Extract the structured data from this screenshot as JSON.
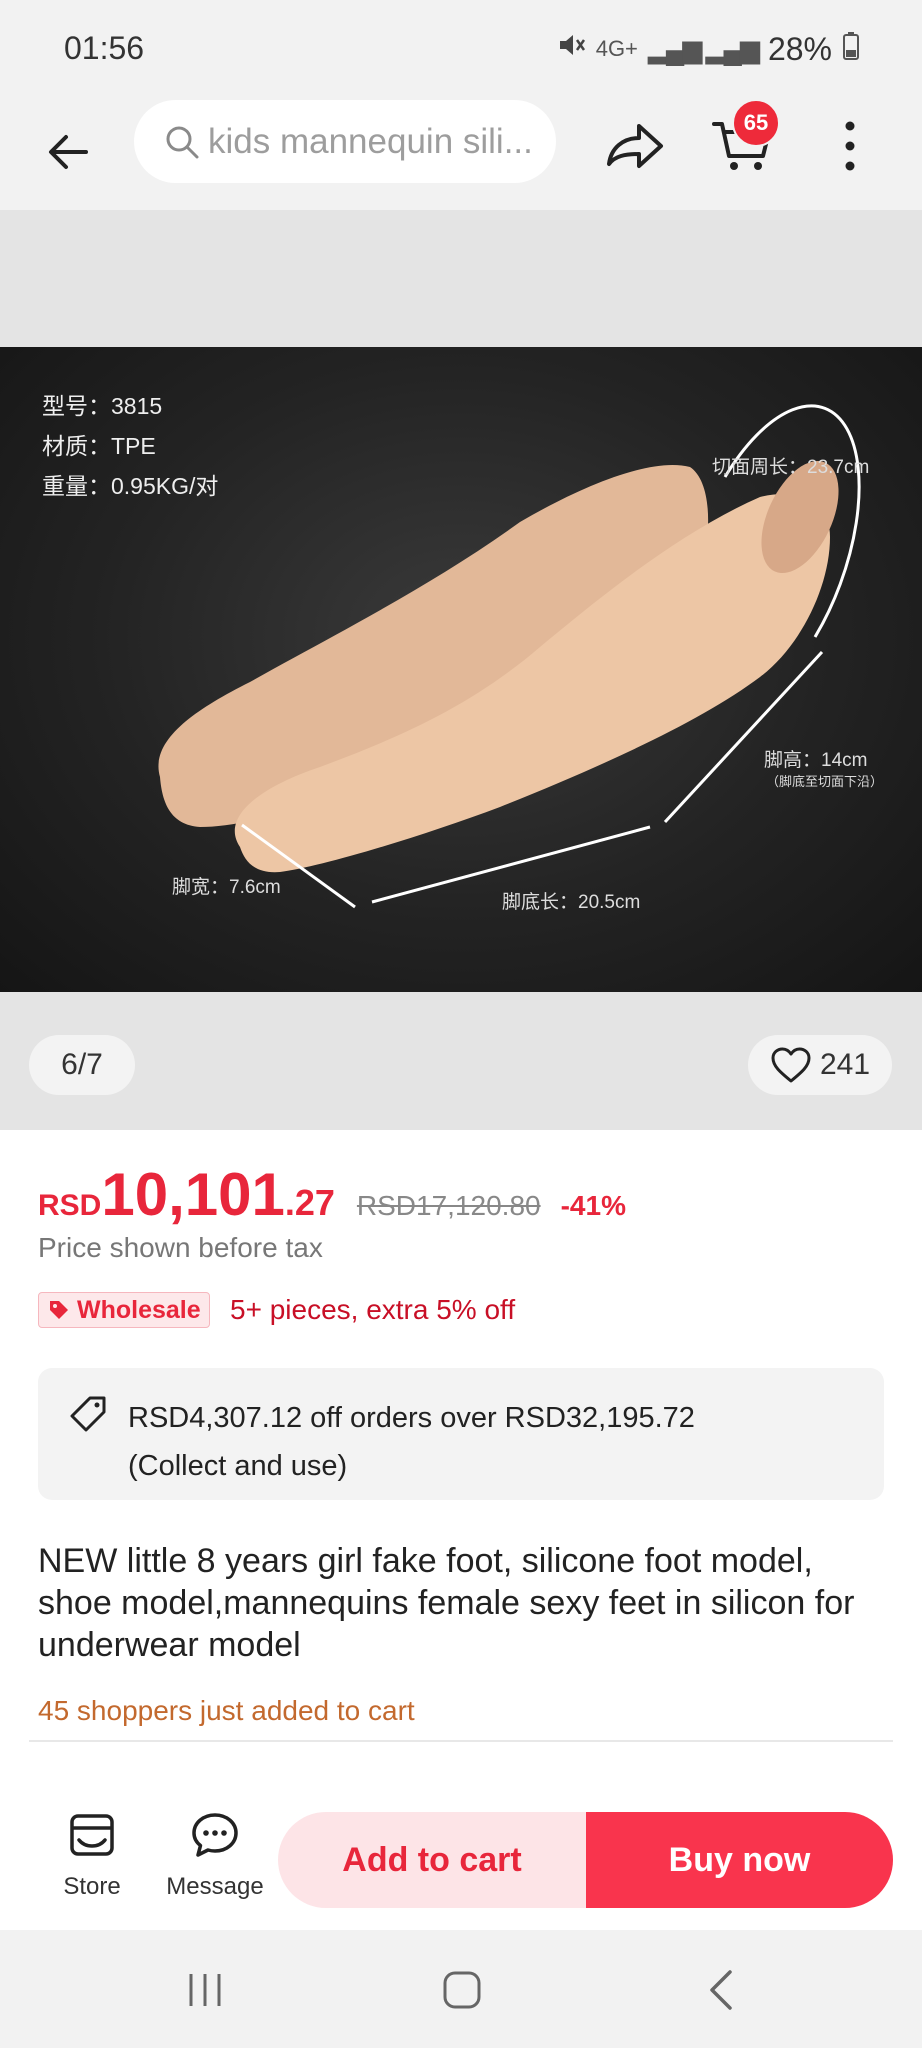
{
  "status_bar": {
    "time": "01:56",
    "network": "4G+",
    "battery": "28%"
  },
  "top_bar": {
    "search_placeholder": "kids mannequin sili...",
    "cart_count": "65"
  },
  "gallery": {
    "counter": "6/7",
    "likes": "241",
    "image_text": {
      "model": "型号：3815",
      "material": "材质：TPE",
      "weight": "重量：0.95KG/对",
      "cut_circumference": "切面周长：23.7cm",
      "height": "脚高：14cm",
      "height_note": "（脚底至切面下沿）",
      "width": "脚宽：7.6cm",
      "sole_length": "脚底长：20.5cm"
    }
  },
  "price": {
    "currency": "RSD",
    "main": "10,101",
    "cents": ".27",
    "original": "RSD17,120.80",
    "discount": "-41%",
    "tax_note": "Price shown before tax"
  },
  "wholesale": {
    "badge": "Wholesale",
    "text": "5+ pieces, extra 5% off"
  },
  "coupon": {
    "line1": "RSD4,307.12 off orders over RSD32,195.72",
    "line2": "(Collect and use)"
  },
  "product": {
    "title": "NEW little 8 years girl  fake foot, silicone foot model, shoe model,mannequins female sexy feet in silicon for underwear model",
    "social_proof": "45 shoppers just added to cart"
  },
  "actions": {
    "store": "Store",
    "message": "Message",
    "add_to_cart": "Add to cart",
    "buy_now": "Buy now"
  },
  "colors": {
    "accent": "#e8263b",
    "buy_now_bg": "#f9344d",
    "add_cart_bg": "#fde4e7",
    "social_proof": "#c3692e"
  }
}
